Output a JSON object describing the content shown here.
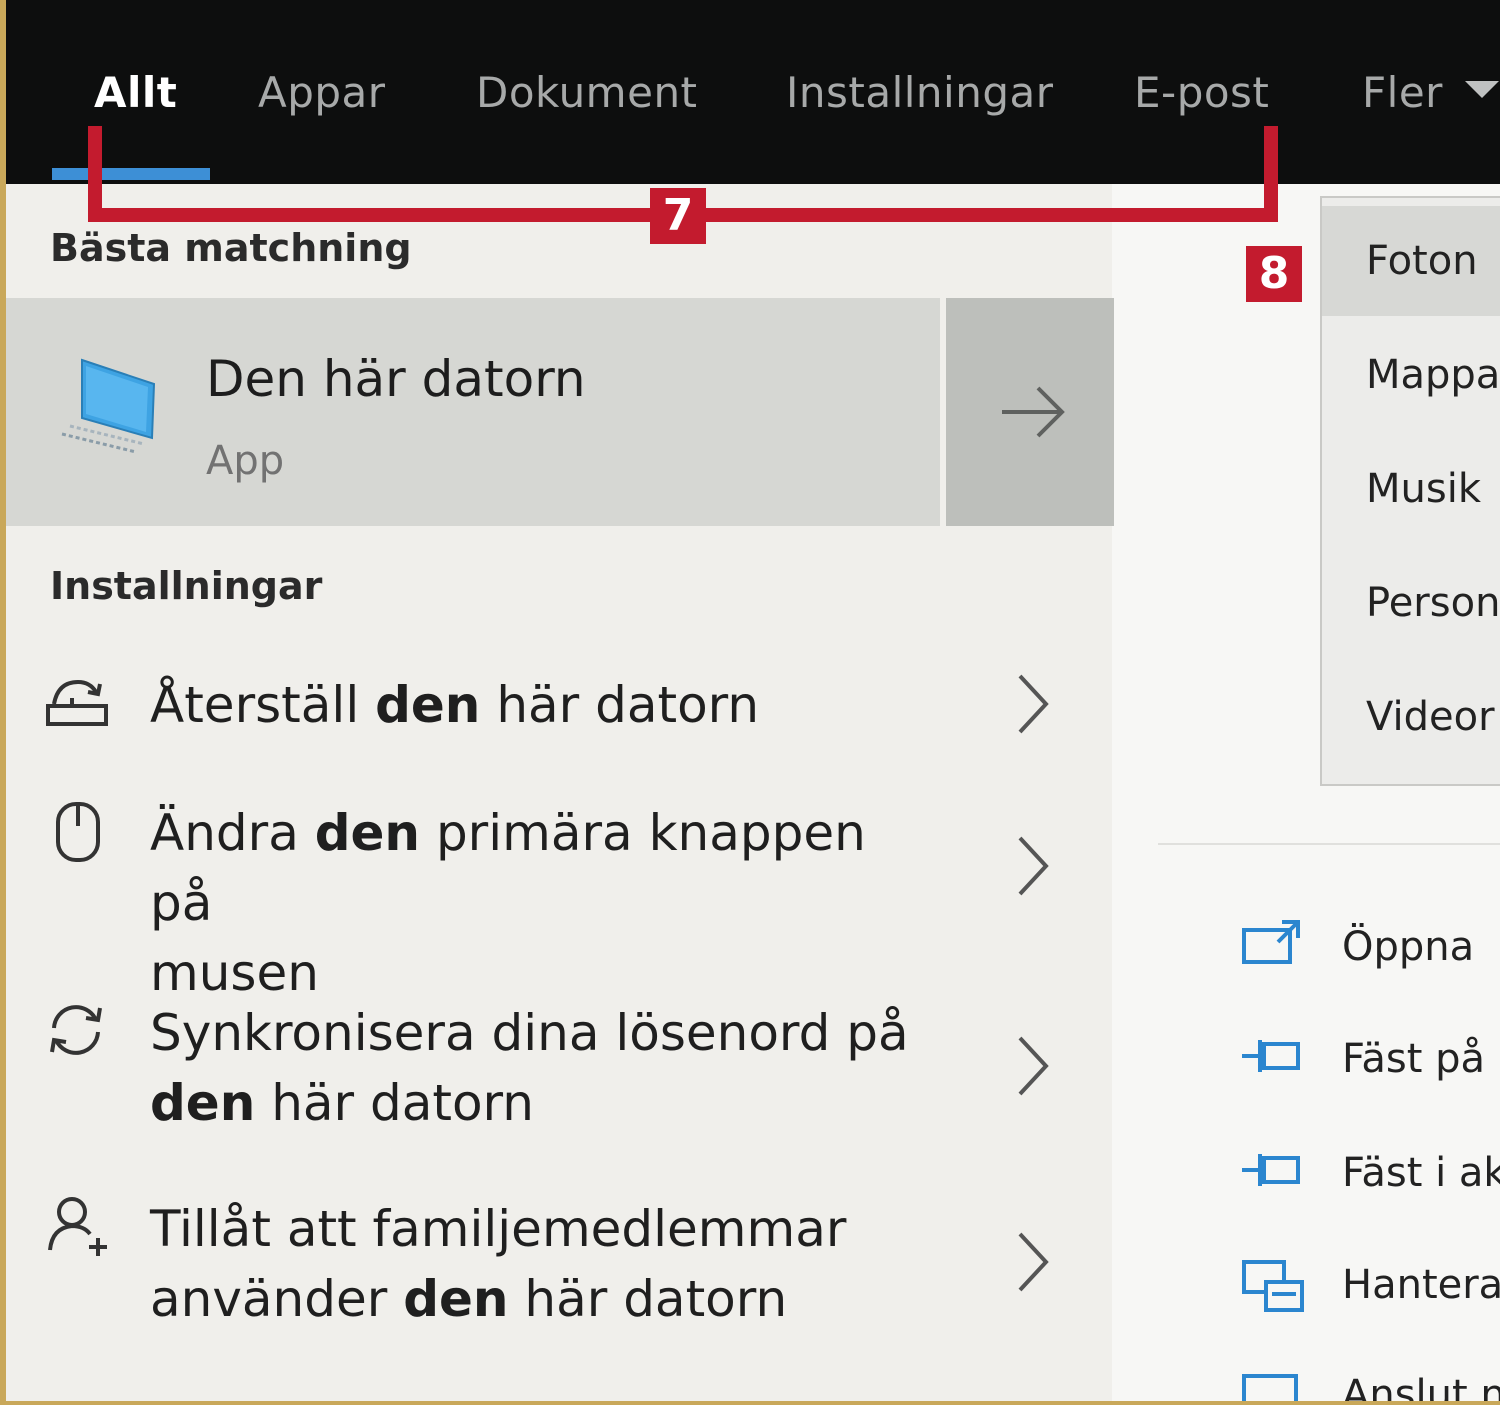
{
  "tabs": [
    {
      "label": "Allt",
      "active": true
    },
    {
      "label": "Appar"
    },
    {
      "label": "Dokument"
    },
    {
      "label": "Installningar"
    },
    {
      "label": "E-post"
    },
    {
      "label": "Fler"
    }
  ],
  "best_match": {
    "section_title": "Bästa matchning",
    "title": "Den här datorn",
    "subtitle": "App"
  },
  "settings": {
    "section_title": "Installningar",
    "items": [
      {
        "line1_pre": "Återställ ",
        "line1_bold": "den",
        "line1_post": " här datorn",
        "line2_pre": "",
        "line2_bold": "",
        "line2_post": ""
      },
      {
        "line1_pre": "Ändra ",
        "line1_bold": "den",
        "line1_post": " primära knappen på",
        "line2_pre": "musen",
        "line2_bold": "",
        "line2_post": ""
      },
      {
        "line1_pre": "Synkronisera dina lösenord på",
        "line1_bold": "",
        "line1_post": "",
        "line2_pre": "",
        "line2_bold": "den",
        "line2_post": " här datorn"
      },
      {
        "line1_pre": "Tillåt att familjemedlemmar",
        "line1_bold": "",
        "line1_post": "",
        "line2_pre": "använder ",
        "line2_bold": "den",
        "line2_post": " här datorn"
      }
    ]
  },
  "dropdown": {
    "items": [
      "Foton",
      "Mappa",
      "Musik",
      "Person",
      "Videor"
    ]
  },
  "actions": {
    "items": [
      "Öppna",
      "Fäst på",
      "Fäst i ak",
      "Hantera",
      "Anslut n"
    ]
  },
  "annotations": {
    "badge_7": "7",
    "badge_8": "8"
  },
  "colors": {
    "accent": "#3d8fd6",
    "annotation": "#c31b2e",
    "topbar": "#0d0e0e"
  }
}
